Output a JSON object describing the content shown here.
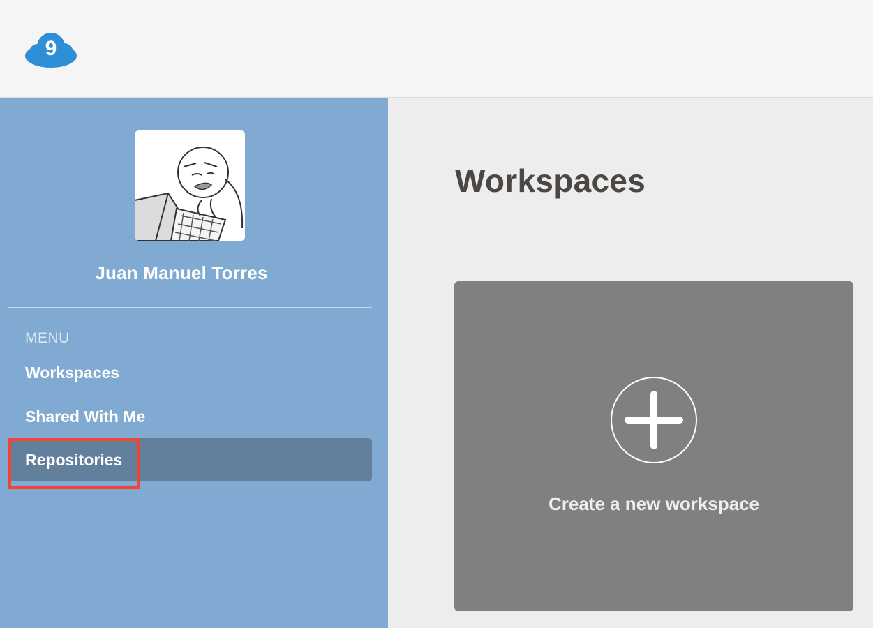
{
  "app": {
    "logo_icon": "cloud9-logo-icon",
    "logo_text": "9",
    "brand_color": "#2f8fd6"
  },
  "sidebar": {
    "avatar_icon": "user-avatar-sketch",
    "user_name": "Juan Manuel Torres",
    "menu_heading": "MENU",
    "items": [
      {
        "label": "Workspaces",
        "active": false
      },
      {
        "label": "Shared With Me",
        "active": false
      },
      {
        "label": "Repositories",
        "active": true
      }
    ],
    "background_color": "#80aad2",
    "active_color": "#627f9b",
    "highlight_color": "#f24430"
  },
  "main": {
    "title": "Workspaces",
    "create_card": {
      "icon": "plus-circle-icon",
      "label": "Create a new workspace",
      "background_color": "#81807e"
    }
  }
}
